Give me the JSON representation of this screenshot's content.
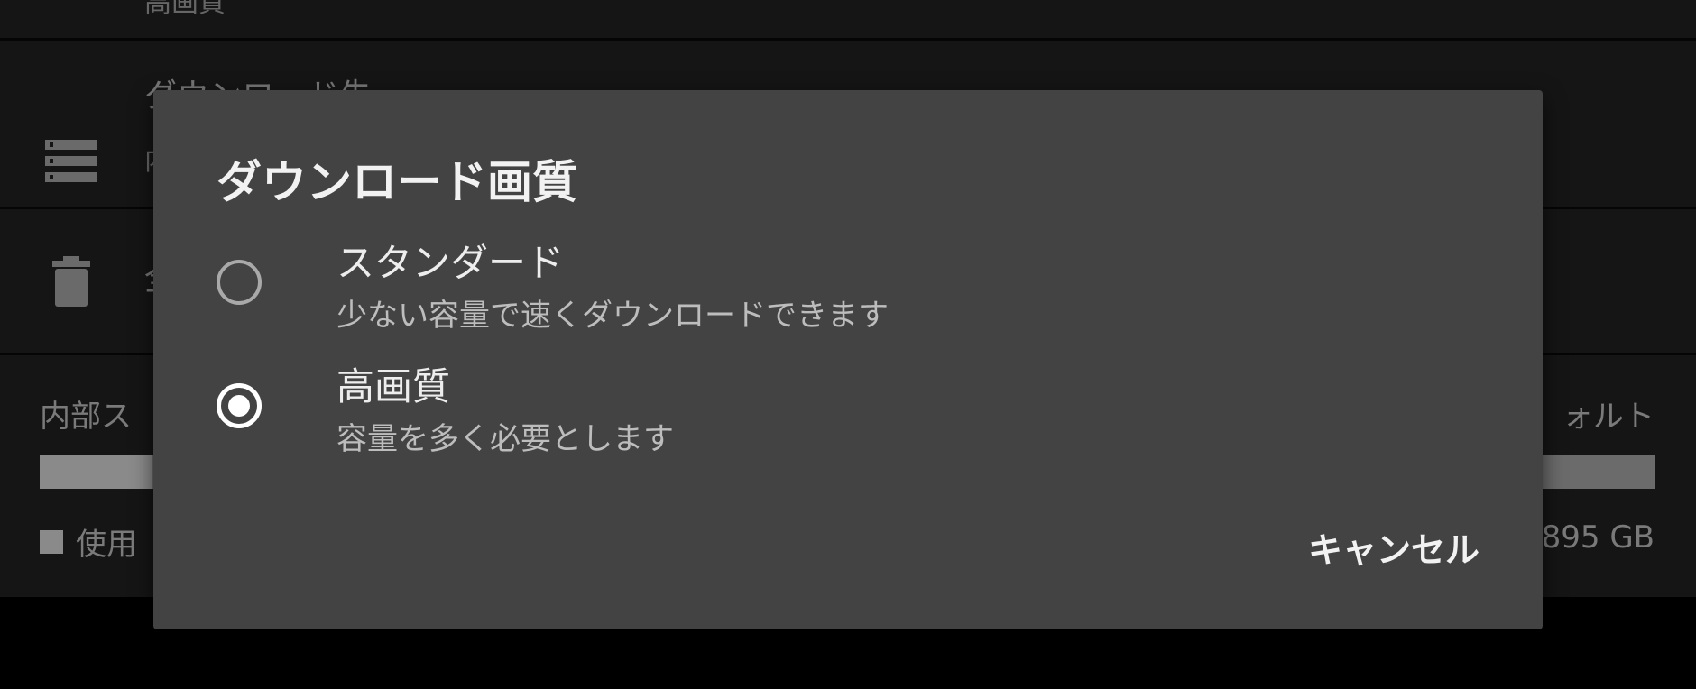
{
  "settings": {
    "top_row": {
      "subtitle": "高画質"
    },
    "download_location": {
      "title": "ダウンロード先",
      "subtitle": "内"
    },
    "delete_downloads": {
      "title": "全"
    },
    "storage": {
      "label_left": "内部ス",
      "label_right": "ォルト",
      "used_legend": "使用",
      "free_value": "895 GB"
    }
  },
  "dialog": {
    "title": "ダウンロード画質",
    "options": [
      {
        "label": "スタンダード",
        "description": "少ない容量で速くダウンロードできます",
        "selected": false
      },
      {
        "label": "高画質",
        "description": "容量を多く必要とします",
        "selected": true
      }
    ],
    "cancel_label": "キャンセル"
  },
  "colors": {
    "dialog_background": "#434343",
    "page_background": "#141414"
  }
}
